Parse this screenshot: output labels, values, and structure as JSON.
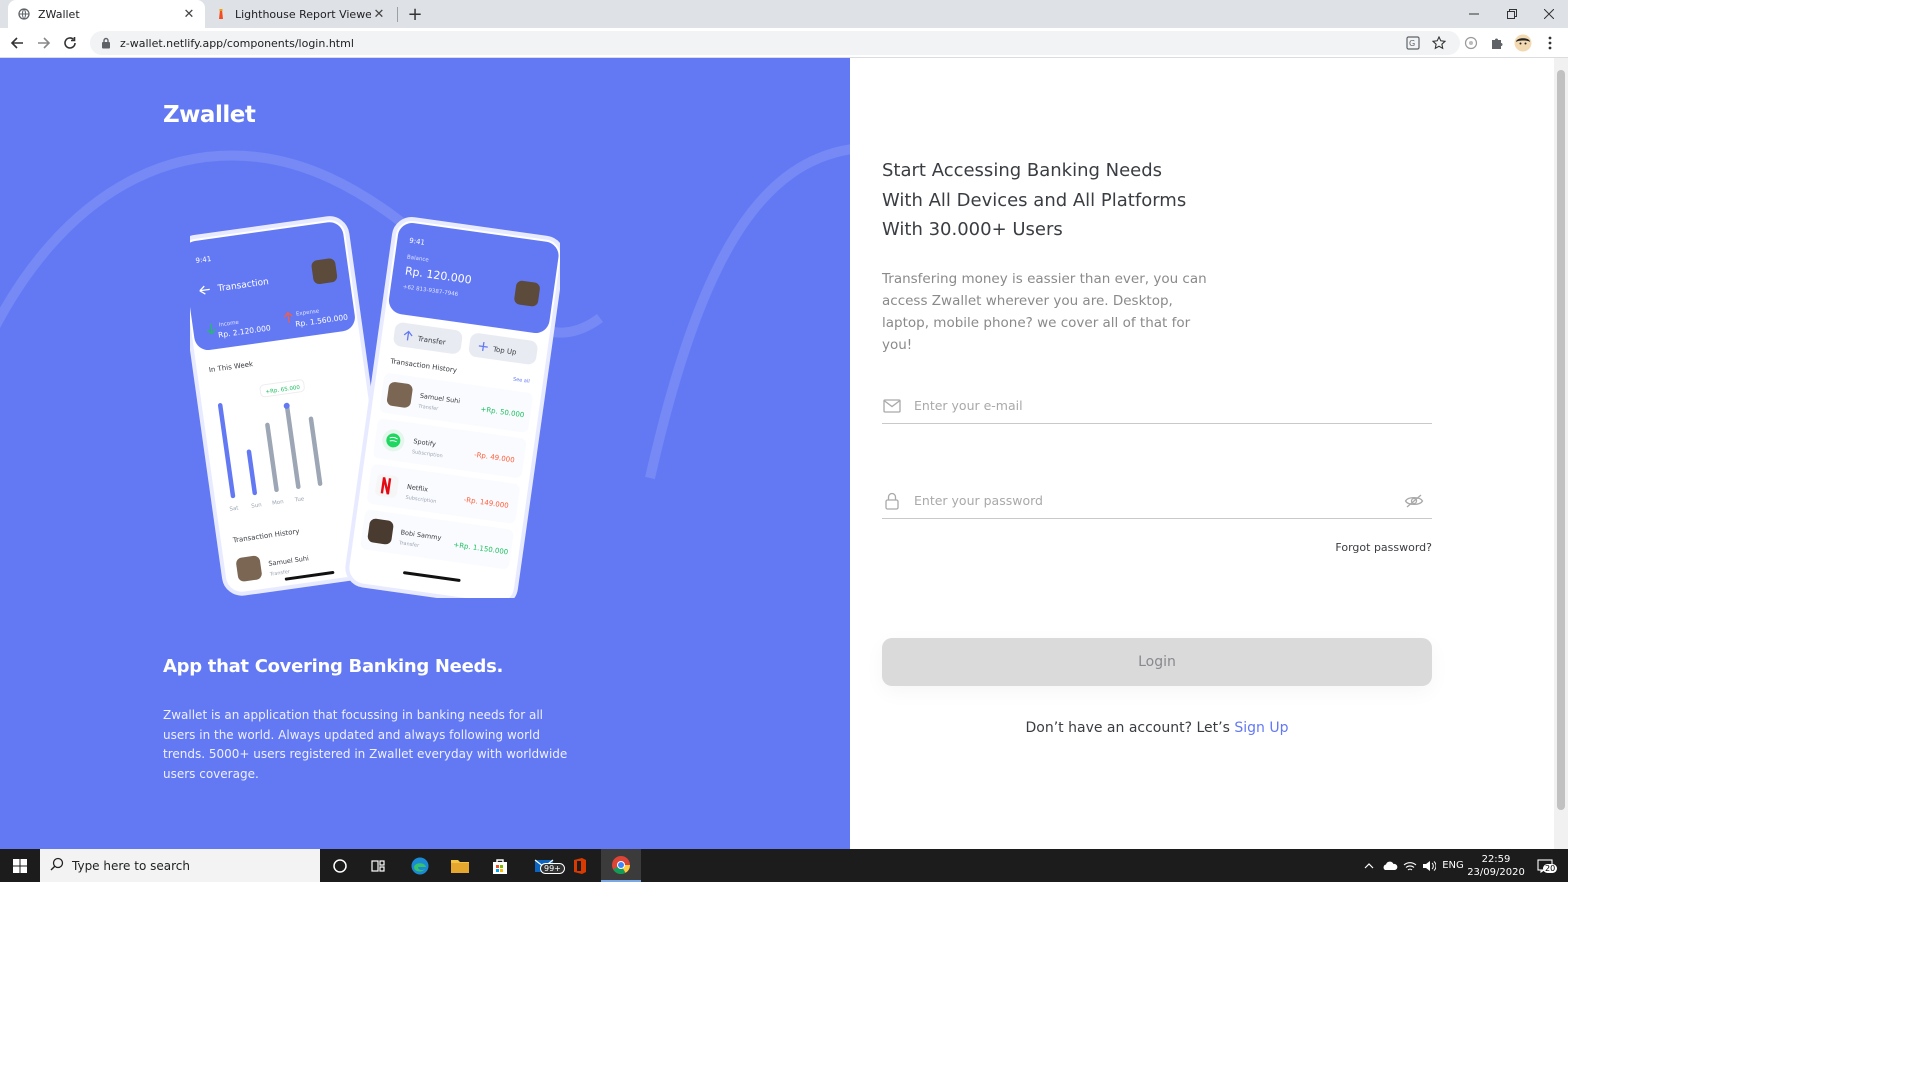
{
  "browser": {
    "tabs": [
      {
        "title": "ZWallet",
        "favicon": "globe-icon",
        "active": true
      },
      {
        "title": "Lighthouse Report Viewer",
        "favicon": "lighthouse-icon",
        "active": false
      }
    ],
    "url": "z-wallet.netlify.app/components/login.html"
  },
  "left": {
    "brand": "Zwallet",
    "heading": "App that Covering Banking Needs.",
    "description": "Zwallet is an application that focussing in banking needs for all users in the world. Always updated and always following world trends. 5000+ users registered in Zwallet everyday with worldwide users coverage.",
    "phone_back": {
      "time": "9:41",
      "title": "Transaction",
      "income_label": "Income",
      "income_value": "Rp. 2.120.000",
      "expense_label": "Expense",
      "expense_value": "Rp. 1.560.000",
      "week_label": "In This Week",
      "chart_tooltip": "+Rp. 65.000",
      "days": [
        "Sat",
        "Sun",
        "Mon",
        "Tue"
      ],
      "history_label": "Transaction History",
      "item_name": "Samuel Suhi",
      "item_type": "Transfer"
    },
    "phone_front": {
      "time": "9:41",
      "balance_label": "Balance",
      "balance_value": "Rp. 120.000",
      "phone": "+62 813-9387-7946",
      "transfer_label": "Transfer",
      "topup_label": "Top Up",
      "history_label": "Transaction History",
      "see_all": "See all",
      "transactions": [
        {
          "name": "Samuel Suhi",
          "type": "Transfer",
          "amount": "+Rp. 50.000",
          "positive": true
        },
        {
          "name": "Spotify",
          "type": "Subscription",
          "amount": "-Rp. 49.000",
          "positive": false
        },
        {
          "name": "Netflix",
          "type": "Subscription",
          "amount": "-Rp. 149.000",
          "positive": false
        },
        {
          "name": "Bobi Sammy",
          "type": "Transfer",
          "amount": "+Rp. 1.150.000",
          "positive": true
        }
      ]
    }
  },
  "right": {
    "headline_lines": [
      "Start Accessing Banking Needs",
      "With All Devices and All Platforms",
      "With 30.000+ Users"
    ],
    "description": "Transfering money is eassier than ever, you can access Zwallet wherever you are. Desktop, laptop, mobile phone? we cover all of that for you!",
    "email_placeholder": "Enter your e-mail",
    "password_placeholder": "Enter your password",
    "forgot": "Forgot password?",
    "login": "Login",
    "signup_prompt": "Don’t have an account? Let’s ",
    "signup_link": "Sign Up"
  },
  "taskbar": {
    "search_placeholder": "Type here to search",
    "mail_badge": "99+",
    "lang": "ENG",
    "time": "22:59",
    "date": "23/09/2020",
    "notif_count": "20"
  },
  "colors": {
    "primary": "#6379f4",
    "positive": "#1ec15f",
    "negative": "#ff5b37"
  }
}
